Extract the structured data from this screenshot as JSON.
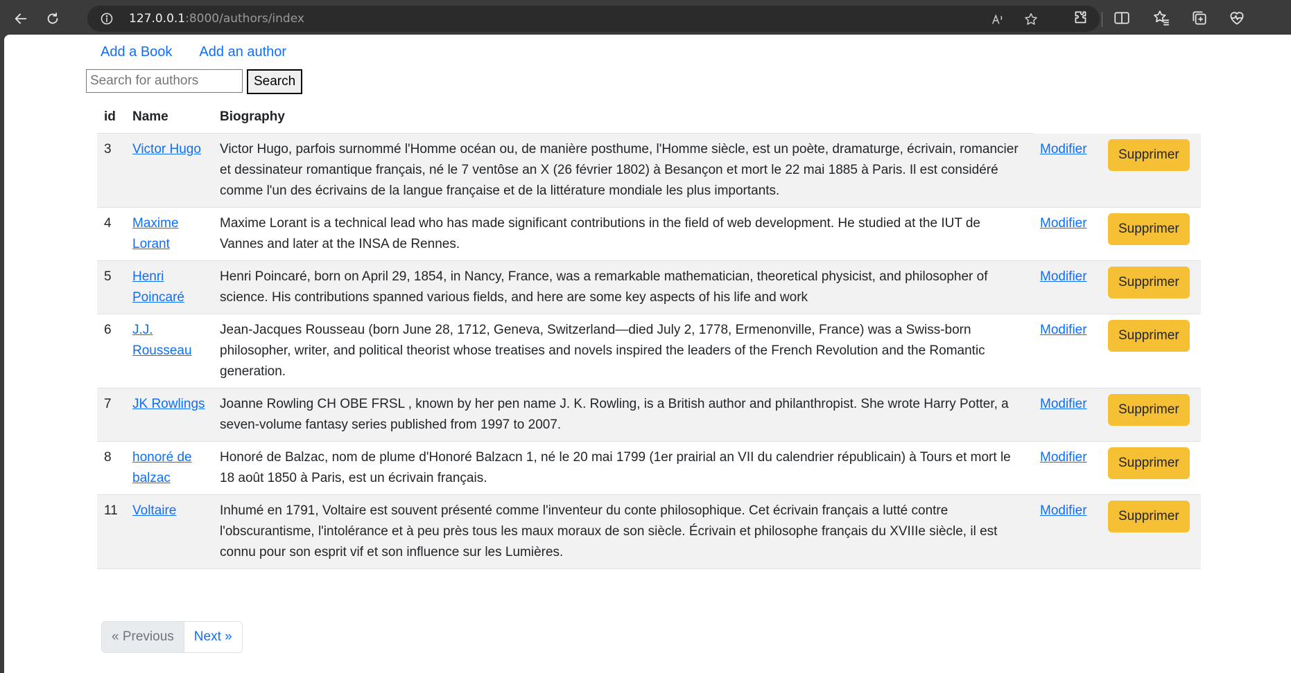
{
  "browser": {
    "url_host": "127.0.0.1",
    "url_path": ":8000/authors/index"
  },
  "nav": {
    "add_book": "Add a Book",
    "add_author": "Add an author"
  },
  "search": {
    "placeholder": "Search for authors",
    "value": "",
    "button": "Search"
  },
  "table": {
    "headers": [
      "id",
      "Name",
      "Biography"
    ],
    "rows": [
      {
        "id": "3",
        "name": "Victor Hugo",
        "bio": "Victor Hugo, parfois surnommé l'Homme océan ou, de manière posthume, l'Homme siècle, est un poète, dramaturge, écrivain, romancier et dessinateur romantique français, né le 7 ventôse an X (26 février 1802) à Besançon et mort le 22 mai 1885 à Paris. Il est considéré comme l'un des écrivains de la langue française et de la littérature mondiale les plus importants.",
        "edit": "Modifier",
        "delete": "Supprimer"
      },
      {
        "id": "4",
        "name": "Maxime Lorant",
        "bio": "Maxime Lorant is a technical lead who has made significant contributions in the field of web development. He studied at the IUT de Vannes and later at the INSA de Rennes.",
        "edit": "Modifier",
        "delete": "Supprimer"
      },
      {
        "id": "5",
        "name": "Henri Poincaré",
        "bio": "Henri Poincaré, born on April 29, 1854, in Nancy, France, was a remarkable mathematician, theoretical physicist, and philosopher of science. His contributions spanned various fields, and here are some key aspects of his life and work",
        "edit": "Modifier",
        "delete": "Supprimer"
      },
      {
        "id": "6",
        "name": "J.J. Rousseau",
        "bio": "Jean-Jacques Rousseau (born June 28, 1712, Geneva, Switzerland—died July 2, 1778, Ermenonville, France) was a Swiss-born philosopher, writer, and political theorist whose treatises and novels inspired the leaders of the French Revolution and the Romantic generation.",
        "edit": "Modifier",
        "delete": "Supprimer"
      },
      {
        "id": "7",
        "name": "JK Rowlings",
        "bio": "Joanne Rowling CH OBE FRSL , known by her pen name J. K. Rowling, is a British author and philanthropist. She wrote Harry Potter, a seven-volume fantasy series published from 1997 to 2007.",
        "edit": "Modifier",
        "delete": "Supprimer"
      },
      {
        "id": "8",
        "name": "honoré de balzac",
        "bio": "Honoré de Balzac, nom de plume d'Honoré Balzacn 1, né le 20 mai 1799 (1er prairial an VII du calendrier républicain) à Tours et mort le 18 août 1850 à Paris, est un écrivain français.",
        "edit": "Modifier",
        "delete": "Supprimer"
      },
      {
        "id": "11",
        "name": "Voltaire",
        "bio": "Inhumé en 1791, Voltaire est souvent présenté comme l'inventeur du conte philosophique. Cet écrivain français a lutté contre l'obscurantisme, l'intolérance et à peu près tous les maux moraux de son siècle. Écrivain et philosophe français du XVIIIe siècle, il est connu pour son esprit vif et son influence sur les Lumières.",
        "edit": "Modifier",
        "delete": "Supprimer"
      }
    ]
  },
  "pagination": {
    "previous": "« Previous",
    "next": "Next »"
  },
  "colors": {
    "link": "#0d6efd",
    "delete_button": "#f5c033",
    "stripe": "#f2f2f2",
    "chrome": "#3b3b3b"
  },
  "icons": {
    "back": "back-arrow-icon",
    "refresh": "refresh-icon",
    "site_info": "info-icon",
    "read_aloud": "read-aloud-icon",
    "favorite": "star-icon",
    "extensions": "puzzle-icon",
    "split_screen": "split-screen-icon",
    "favorites": "favorites-icon",
    "collections": "collections-icon",
    "performance": "heart-pulse-icon"
  }
}
